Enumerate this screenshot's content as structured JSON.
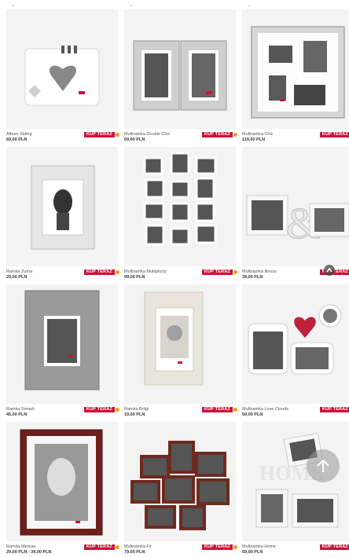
{
  "buy_label": "KUP TERAZ",
  "products": [
    {
      "name": "Album Siding",
      "price": "69,00 PLN",
      "coin": true
    },
    {
      "name": "Multiramka Double Chic",
      "price": "69,00 PLN",
      "coin": true
    },
    {
      "name": "Multiramka Chic",
      "price": "119,00 PLN",
      "coin": false
    },
    {
      "name": "Ramka Zuma",
      "price": "29,00 PLN",
      "coin": true
    },
    {
      "name": "Multiramka Multiplicity",
      "price": "99,00 PLN",
      "coin": true
    },
    {
      "name": "Multiramka Illinois",
      "price": "39,00 PLN",
      "coin": false
    },
    {
      "name": "Ramka Smash",
      "price": "45,00 PLN",
      "coin": true
    },
    {
      "name": "Ramka Brilgi",
      "price": "19,00 PLN",
      "coin": true
    },
    {
      "name": "Multiramka Love Clouds",
      "price": "59,00 PLN",
      "coin": false
    },
    {
      "name": "Ramka Merbau",
      "price": "29,00 PLN - 39,00 PLN",
      "coin": true
    },
    {
      "name": "Multiramka Fir",
      "price": "79,00 PLN",
      "coin": true
    },
    {
      "name": "Multiramka Home",
      "price": "59,00 PLN",
      "coin": false
    }
  ],
  "colors": {
    "buy": "#d0103a",
    "coin": "#e8a317"
  },
  "icons": {
    "scroll_top": "arrow-up-icon",
    "scroll_up_small": "chevron-up-icon"
  }
}
